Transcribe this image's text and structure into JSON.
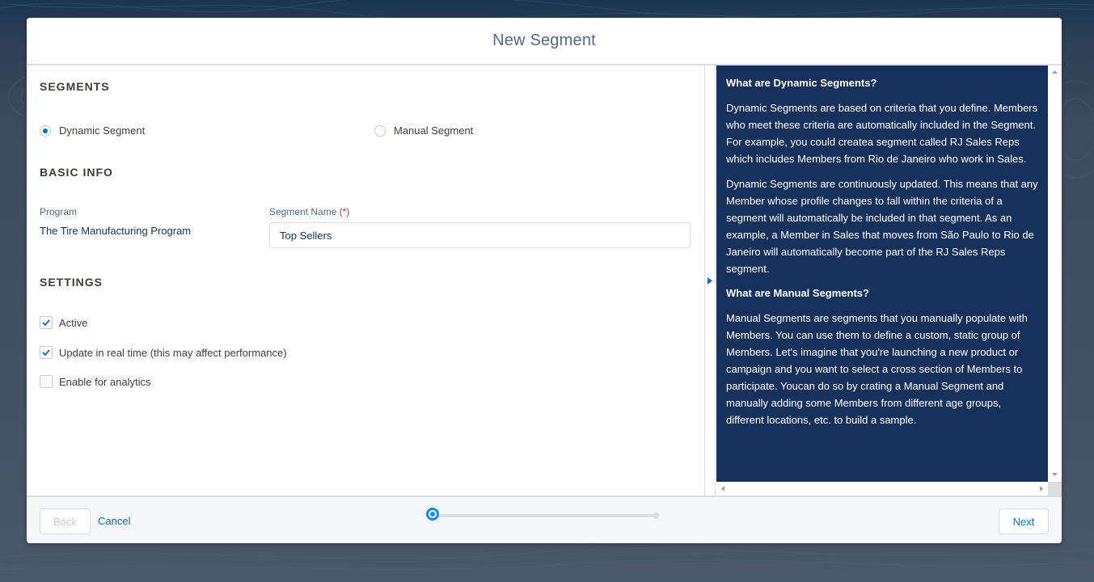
{
  "modal": {
    "title": "New Segment"
  },
  "segments": {
    "heading": "SEGMENTS",
    "options": [
      {
        "label": "Dynamic Segment",
        "checked": true
      },
      {
        "label": "Manual Segment",
        "checked": false
      }
    ]
  },
  "basic_info": {
    "heading": "BASIC INFO",
    "program_label": "Program",
    "program_value": "The Tire Manufacturing Program",
    "segment_name_label": "Segment Name",
    "required_marker": "(*)",
    "segment_name_value": "Top Sellers"
  },
  "settings": {
    "heading": "SETTINGS",
    "options": [
      {
        "label": "Active",
        "checked": true
      },
      {
        "label": "Update in real time (this may affect performance)",
        "checked": true
      },
      {
        "label": "Enable for analytics",
        "checked": false
      }
    ]
  },
  "help": {
    "dynamic_heading": "What are Dynamic Segments?",
    "dynamic_p1": "Dynamic Segments are based on criteria that you define. Members who meet these criteria are automatically included in the Segment. For example, you could createa segment called RJ Sales Reps which includes Members from Rio de Janeiro who work in Sales.",
    "dynamic_p2": "Dynamic Segments are continuously updated. This means that any Member whose profile changes to fall within the criteria of a segment will automatically be included in that segment. As an example, a Member in Sales that moves from São Paulo to Rio de Janeiro will automatically become part of the RJ Sales Reps segment.",
    "manual_heading": "What are Manual Segments?",
    "manual_p1": "Manual Segments are segments that you manually populate with Members. You can use them to define a custom, static group of Members. Let's imagine that you're launching a new product or campaign and you want to select a cross section of Members to participate. Youcan do so by crating a Manual Segment and manually adding some Members from different age groups, different locations, etc. to build a sample."
  },
  "footer": {
    "back_label": "Back",
    "cancel_label": "Cancel",
    "next_label": "Next",
    "progress": 0
  },
  "colors": {
    "brand_blue": "#0070d2",
    "help_bg": "#16325c",
    "progress_active": "#1589ee"
  }
}
